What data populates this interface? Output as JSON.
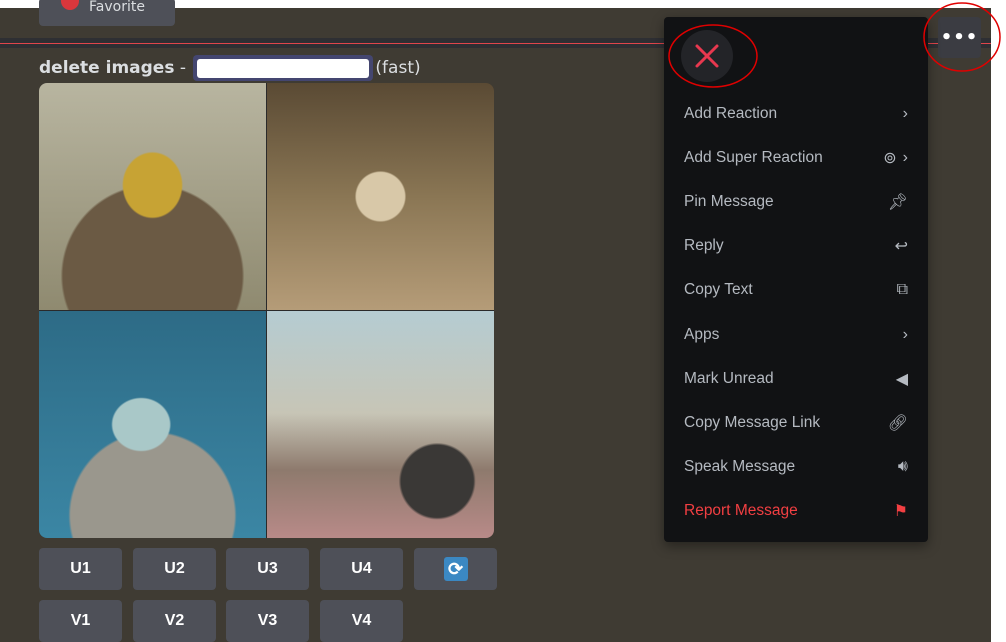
{
  "favorite_label": "Favorite",
  "message": {
    "title": "delete images",
    "separator": "-",
    "mode": "(fast)"
  },
  "buttons": {
    "upscale": [
      "U1",
      "U2",
      "U3",
      "U4"
    ],
    "variation": [
      "V1",
      "V2",
      "V3",
      "V4"
    ],
    "reroll_icon": "refresh-icon"
  },
  "menu": {
    "items": [
      {
        "label": "Add Reaction",
        "icon": "chevron-right-icon"
      },
      {
        "label": "Add Super Reaction",
        "icon": "super-reaction-icon"
      },
      {
        "label": "Pin Message",
        "icon": "pin-icon"
      },
      {
        "label": "Reply",
        "icon": "reply-icon"
      },
      {
        "label": "Copy Text",
        "icon": "copy-icon"
      },
      {
        "label": "Apps",
        "icon": "chevron-right-icon"
      },
      {
        "label": "Mark Unread",
        "icon": "mark-unread-icon"
      },
      {
        "label": "Copy Message Link",
        "icon": "link-icon"
      },
      {
        "label": "Speak Message",
        "icon": "speak-icon"
      },
      {
        "label": "Report Message",
        "icon": "flag-icon",
        "danger": true
      }
    ]
  },
  "colors": {
    "danger": "#f23f42",
    "annotation": "#e00000",
    "background": "#3f3b33",
    "menu": "#111214"
  }
}
